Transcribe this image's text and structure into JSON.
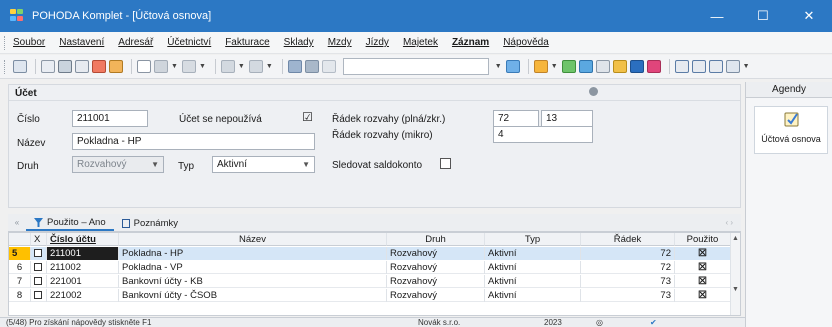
{
  "window": {
    "title": "POHODA Komplet - [Účtová osnova]"
  },
  "menu": [
    "Soubor",
    "Nastavení",
    "Adresář",
    "Účetnictví",
    "Fakturace",
    "Sklady",
    "Mzdy",
    "Jízdy",
    "Majetek",
    "Záznam",
    "Nápověda"
  ],
  "form": {
    "section": "Účet",
    "cislo_label": "Číslo",
    "cislo_value": "211001",
    "nepouziva_label": "Účet se nepoužívá",
    "nepouziva_checked": "☑",
    "nazev_label": "Název",
    "nazev_value": "Pokladna - HP",
    "druh_label": "Druh",
    "druh_value": "Rozvahový",
    "typ_label": "Typ",
    "typ_value": "Aktivní",
    "radek_plna_label": "Řádek rozvahy (plná/zkr.)",
    "radek_plna_value": "72",
    "radek_zkr_value": "13",
    "radek_mikro_label": "Řádek rozvahy (mikro)",
    "radek_mikro_value": "4",
    "saldokonto_label": "Sledovat saldokonto"
  },
  "agendy": {
    "header": "Agendy",
    "item_label": "Účtová osnova"
  },
  "tabs": [
    {
      "label": "Použito – Ano"
    },
    {
      "label": "Poznámky"
    }
  ],
  "table": {
    "headers": [
      "X",
      "Číslo účtu",
      "Název",
      "Druh",
      "Typ",
      "Řádek",
      "Použito"
    ],
    "rows": [
      {
        "num": "5",
        "code": "211001",
        "name": "Pokladna - HP",
        "druh": "Rozvahový",
        "typ": "Aktivní",
        "radek": "72"
      },
      {
        "num": "6",
        "code": "211002",
        "name": "Pokladna - VP",
        "druh": "Rozvahový",
        "typ": "Aktivní",
        "radek": "72"
      },
      {
        "num": "7",
        "code": "221001",
        "name": "Bankovní účty - KB",
        "druh": "Rozvahový",
        "typ": "Aktivní",
        "radek": "73"
      },
      {
        "num": "8",
        "code": "221002",
        "name": "Bankovní účty - ČSOB",
        "druh": "Rozvahový",
        "typ": "Aktivní",
        "radek": "73"
      }
    ]
  },
  "status": {
    "help": "(5/48) Pro získání nápovědy stiskněte F1",
    "company": "Novák  s.r.o.",
    "year": "2023"
  },
  "icons": {
    "used": "checked-x-icon",
    "scroll_up": "▲",
    "scroll_down": "▼"
  }
}
